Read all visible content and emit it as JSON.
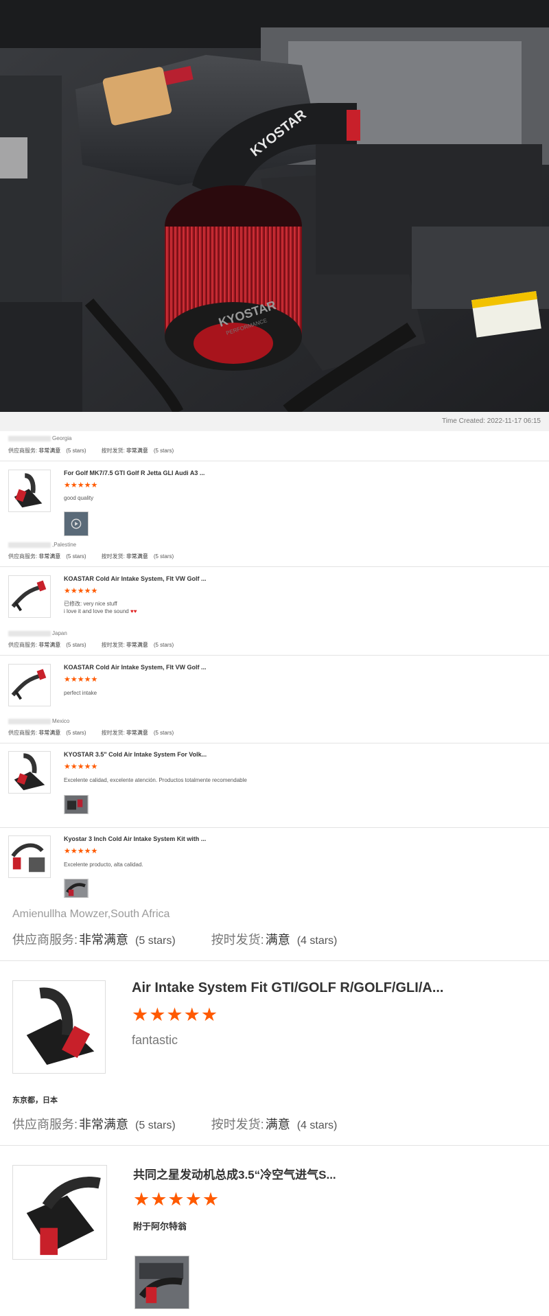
{
  "hero": {
    "brand_text": "KYOSTAR",
    "brand_sub": "PERFORMANCE",
    "time_created": "Time Created: 2022-11-17 06:15"
  },
  "labels": {
    "service": "供应商服务:",
    "shipping": "按时发货:"
  },
  "reviews": [
    {
      "user": "Georgia",
      "service_value": "非常满意",
      "service_stars": "(5 stars)",
      "shipping_value": "非常满意",
      "shipping_stars": "(5 stars)",
      "product_title": "For Golf MK7/7.5 GTI Golf R Jetta GLI Audi A3 ...",
      "stars": "★★★★★",
      "comment": "good quality",
      "comment2": "",
      "has_photo": true
    },
    {
      "user": ",Palestine",
      "service_value": "非常满意",
      "service_stars": "(5 stars)",
      "shipping_value": "非常满意",
      "shipping_stars": "(5 stars)",
      "product_title": "KOASTAR Cold Air Intake System, FIt VW Golf ...",
      "stars": "★★★★★",
      "comment": "已修改: very nice stuff",
      "comment2": "i love it and love the sound",
      "hearts": "♥♥",
      "has_photo": false
    },
    {
      "user": "Japan",
      "service_value": "非常满意",
      "service_stars": "(5 stars)",
      "shipping_value": "非常满意",
      "shipping_stars": "(5 stars)",
      "product_title": "KOASTAR Cold Air Intake System, FIt VW Golf ...",
      "stars": "★★★★★",
      "comment": "perfect intake",
      "comment2": "",
      "has_photo": false
    },
    {
      "user": "Mexico",
      "service_value": "非常满意",
      "service_stars": "(5 stars)",
      "shipping_value": "非常满意",
      "shipping_stars": "(5 stars)",
      "product_title": "KYOSTAR 3.5\" Cold Air Intake System For Volk...",
      "stars": "★★★★★",
      "comment": "Excelente calidad, excelente atención. Productos totalmente recomendable",
      "comment2": "",
      "has_photo": true
    },
    {
      "user": "",
      "product_title": "Kyostar 3 Inch Cold Air Intake System Kit with ...",
      "stars": "★★★★★",
      "comment": "Excelente producto, alta calidad.",
      "has_photo": true
    }
  ],
  "large_reviews": [
    {
      "user": "Amienullha Mowzer,South Africa",
      "service_value": "非常满意",
      "service_stars": "(5 stars)",
      "shipping_value": "满意",
      "shipping_stars": "(4 stars)",
      "product_title": "Air Intake System Fit GTI/GOLF R/GOLF/GLI/A...",
      "stars": "★★★★★",
      "comment": "fantastic"
    },
    {
      "user": "东京都，日本",
      "service_value": "非常满意",
      "service_stars": "(5 stars)",
      "shipping_value": "满意",
      "shipping_stars": "(4 stars)",
      "product_title": "共同之星发动机总成3.5“冷空气进气S...",
      "stars": "★★★★★",
      "comment": "附于阿尔特翁"
    }
  ],
  "colors": {
    "accent_star": "#ff5a00",
    "filter_red": "#c8202a"
  }
}
